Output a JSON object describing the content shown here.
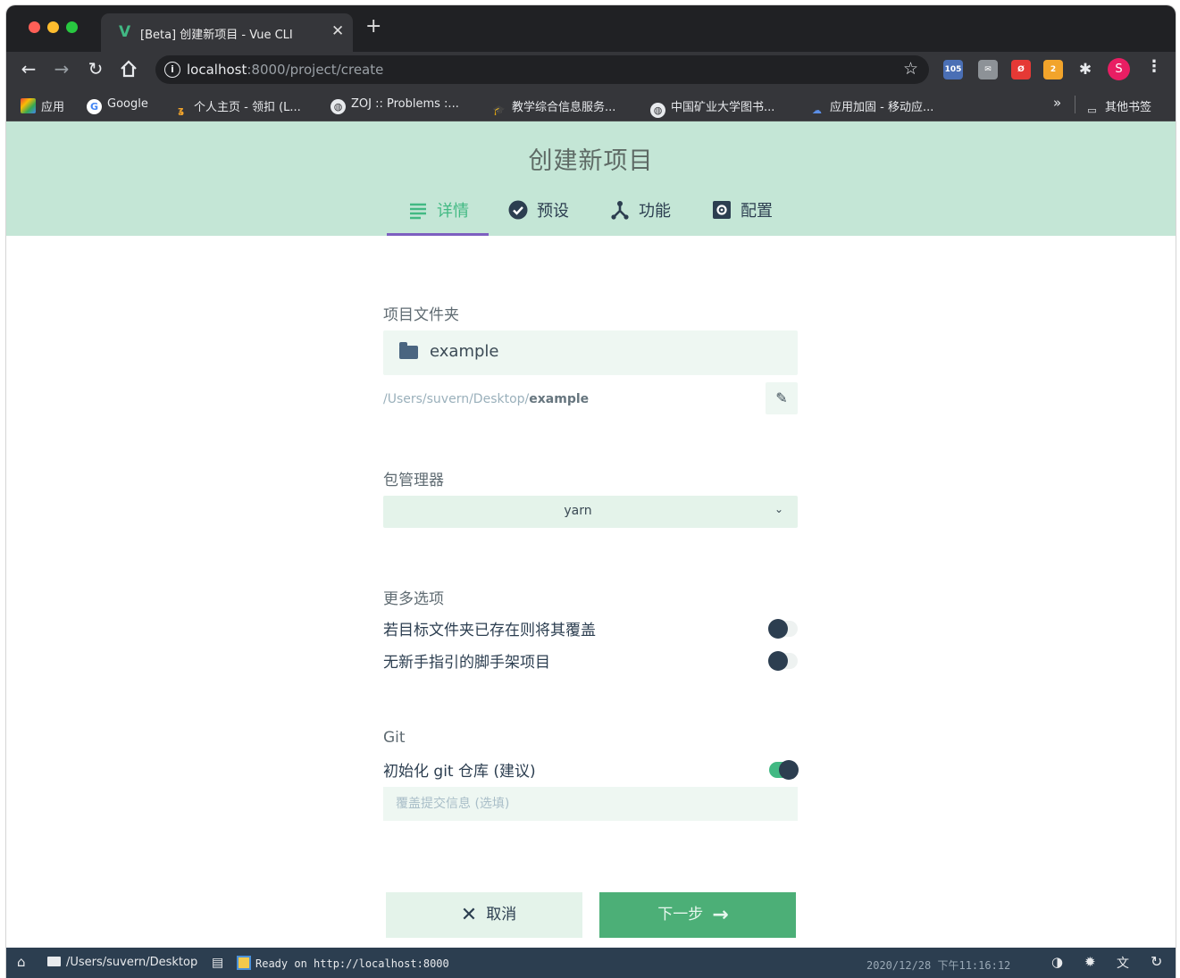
{
  "browser": {
    "tab_favicon": "V",
    "tab_title": "[Beta] 创建新项目 - Vue CLI",
    "tab_close": "✕",
    "new_tab": "+",
    "url_host": "localhost",
    "url_path": ":8000/project/create",
    "avatar_initial": "S",
    "extensions": [
      {
        "icon": "calendar-icon",
        "badge": "105",
        "color": "#4a6fb5"
      },
      {
        "icon": "mail-icon",
        "badge": "",
        "color": "#9aa0a6"
      },
      {
        "icon": "app-icon",
        "badge": "",
        "color": "#e53935"
      },
      {
        "icon": "rss-icon",
        "badge": "2",
        "color": "#f2a42b"
      },
      {
        "icon": "puzzle-icon",
        "badge": "",
        "color": "#e8eaed"
      }
    ]
  },
  "bookmarks": {
    "items": [
      {
        "label": "应用",
        "icon": "apps-grid-icon"
      },
      {
        "label": "Google",
        "icon": "google-icon"
      },
      {
        "label": "个人主页 - 领扣 (L...",
        "icon": "leetcode-icon"
      },
      {
        "label": "ZOJ :: Problems :...",
        "icon": "globe-icon"
      },
      {
        "label": "教学综合信息服务...",
        "icon": "school-icon"
      },
      {
        "label": "中国矿业大学图书...",
        "icon": "globe-icon"
      },
      {
        "label": "应用加固 - 移动应...",
        "icon": "cloud-icon"
      }
    ],
    "overflow": "»",
    "other": "其他书签"
  },
  "page": {
    "title": "创建新项目",
    "steps": [
      {
        "label": "详情",
        "icon": "details-icon",
        "active": true
      },
      {
        "label": "预设",
        "icon": "check-circle-icon",
        "active": false
      },
      {
        "label": "功能",
        "icon": "fork-icon",
        "active": false
      },
      {
        "label": "配置",
        "icon": "settings-box-icon",
        "active": false
      }
    ]
  },
  "form": {
    "folder_label": "项目文件夹",
    "folder_value": "example",
    "path_prefix": "/Users/suvern/Desktop/",
    "path_name": "example",
    "pm_label": "包管理器",
    "pm_value": "yarn",
    "more_options_label": "更多选项",
    "option_overwrite": "若目标文件夹已存在则将其覆盖",
    "option_overwrite_on": false,
    "option_no_guide": "无新手指引的脚手架项目",
    "option_no_guide_on": false,
    "git_label": "Git",
    "git_init": "初始化 git 仓库 (建议)",
    "git_init_on": true,
    "commit_placeholder": "覆盖提交信息 (选填)",
    "cancel_label": "取消",
    "next_label": "下一步"
  },
  "statusbar": {
    "cwd": "/Users/suvern/Desktop",
    "log": "Ready on http://localhost:8000",
    "datetime": "2020/12/28 下午11:16:12"
  }
}
